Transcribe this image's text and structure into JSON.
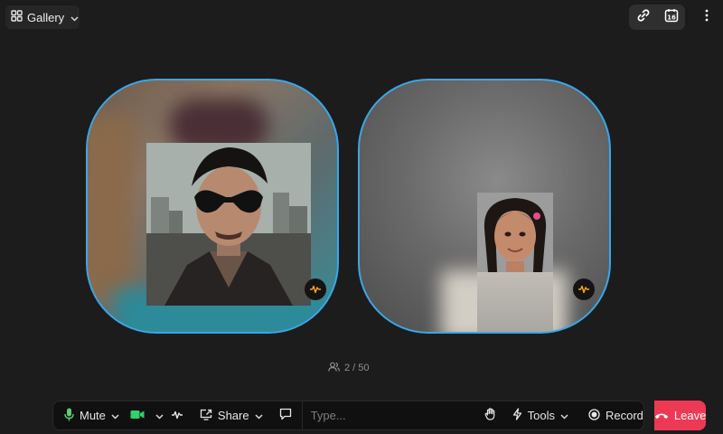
{
  "header": {
    "view_label": "Gallery",
    "view_icon": "grid-icon",
    "right_icons": [
      "link-icon",
      "calendar-icon",
      "more-vertical-icon"
    ],
    "calendar_day": "16"
  },
  "participants": {
    "count_text": "2 / 50"
  },
  "toolbar": {
    "mute_label": "Mute",
    "share_label": "Share",
    "chat_placeholder": "Type...",
    "tools_label": "Tools",
    "record_label": "Record",
    "leave_label": "Leave"
  },
  "colors": {
    "background": "#1c1c1c",
    "tile_border": "#3aa6e8",
    "leave": "#ec3a55",
    "mic": "#5ccf6a",
    "camera": "#2ed46a"
  }
}
